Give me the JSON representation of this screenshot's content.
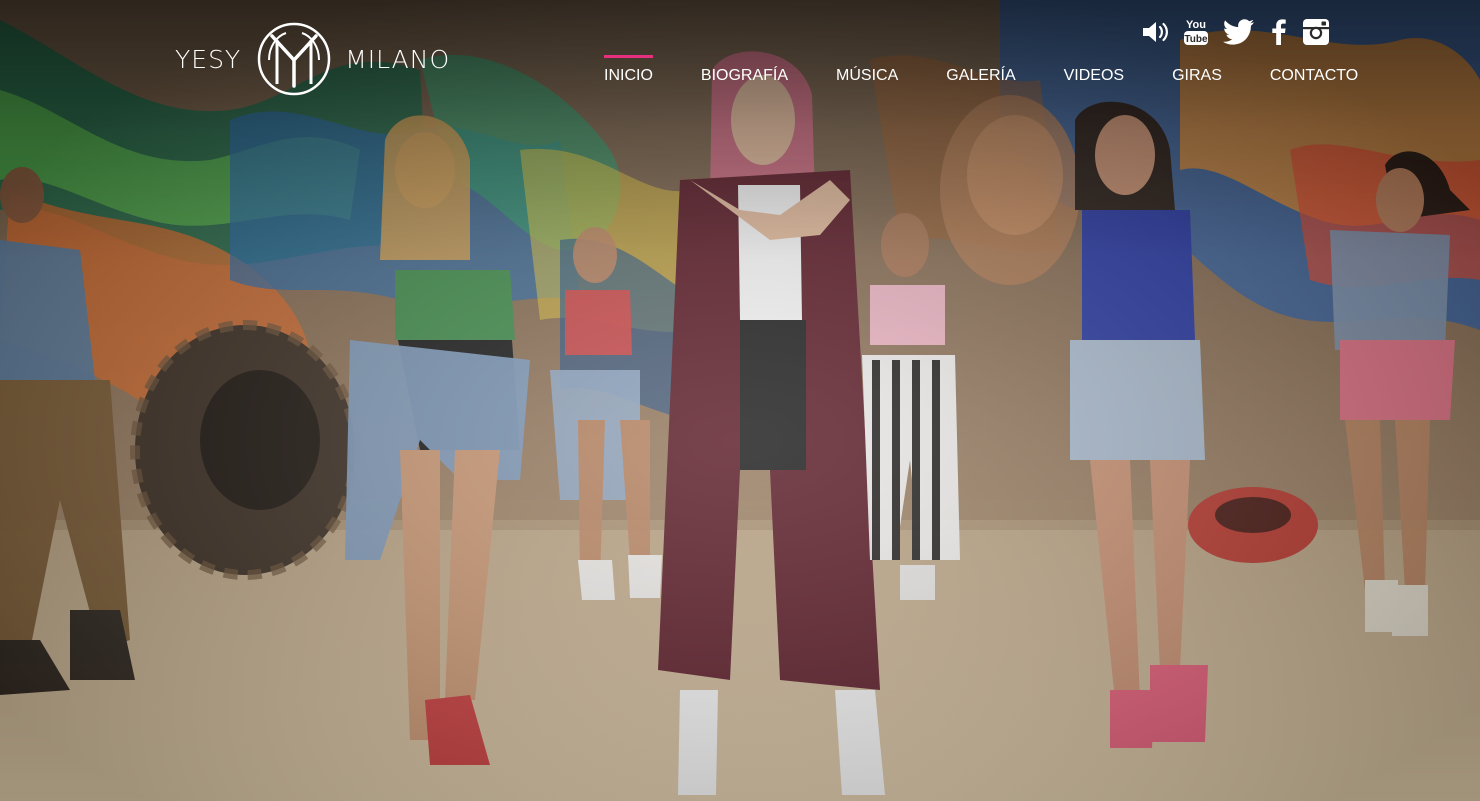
{
  "brand": {
    "first": "YESY",
    "last": "MILANO",
    "monogram": "YM"
  },
  "nav": {
    "active_color": "#e5307f",
    "items": [
      {
        "label": "INICIO",
        "active": true
      },
      {
        "label": "BIOGRAFÍA",
        "active": false
      },
      {
        "label": "MÚSICA",
        "active": false
      },
      {
        "label": "GALERÍA",
        "active": false
      },
      {
        "label": "VIDEOS",
        "active": false
      },
      {
        "label": "GIRAS",
        "active": false
      },
      {
        "label": "CONTACTO",
        "active": false
      }
    ]
  },
  "social": {
    "icons": [
      "speaker-icon",
      "youtube-icon",
      "twitter-icon",
      "facebook-icon",
      "instagram-icon"
    ],
    "youtube_text": "You Tube"
  },
  "hero": {
    "background": "graffiti-wall-dancers-photo"
  }
}
